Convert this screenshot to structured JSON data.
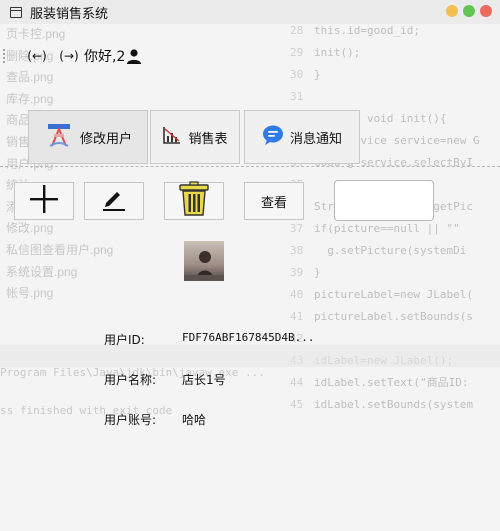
{
  "window": {
    "title": "服装销售系统",
    "controls": {
      "minimize_color": "#f5bf4f",
      "maximize_color": "#61c554",
      "close_color": "#ed6a5e"
    }
  },
  "nav": {
    "back_label": "(←)",
    "forward_label": "(→)",
    "greeting": "你好,2"
  },
  "tabs": [
    {
      "label": "修改用户",
      "icon": "user-edit-icon"
    },
    {
      "label": "销售表",
      "icon": "bar-chart-icon"
    },
    {
      "label": "消息通知",
      "icon": "chat-bubble-icon"
    }
  ],
  "toolbar": {
    "add_icon": "plus-icon",
    "edit_icon": "pen-icon",
    "delete_icon": "trash-icon",
    "view_label": "查看",
    "search_value": ""
  },
  "user": {
    "id_label": "用户ID:",
    "id_value": "FDF76ABF167845D4B...",
    "name_label": "用户名称:",
    "name_value": "店长1号",
    "account_label": "用户账号:",
    "account_value": "哈哈"
  },
  "background": {
    "files": [
      "页卡控.png",
      "删除.png",
      "查品.png",
      "库存.png",
      "商品部管理.png",
      "销售.png",
      "用户.png",
      "统计.png",
      "添加.png",
      "修改.png",
      "私信图查看用户.png",
      "系统设置.png",
      "帐号.png"
    ],
    "code_lines": [
      {
        "n": "28",
        "t": "this.id=good_id;"
      },
      {
        "n": "29",
        "t": "init();"
      },
      {
        "n": "30",
        "t": "}"
      },
      {
        "n": "31",
        "t": ""
      },
      {
        "n": "32",
        "t": "private void init(){"
      },
      {
        "n": "33",
        "t": "GoodService service=new G"
      },
      {
        "n": "34",
        "t": "Good g=service.selectByI"
      },
      {
        "n": "35",
        "t": ""
      },
      {
        "n": "36",
        "t": "String picture= g.getPic"
      },
      {
        "n": "37",
        "t": "if(picture==null || \"\""
      },
      {
        "n": "38",
        "t": "  g.setPicture(systemDi"
      },
      {
        "n": "39",
        "t": "}"
      },
      {
        "n": "40",
        "t": "pictureLabel=new JLabel("
      },
      {
        "n": "41",
        "t": "pictureLabel.setBounds(s"
      },
      {
        "n": "42",
        "t": ""
      },
      {
        "n": "43",
        "t": "idLabel=new JLabel();"
      },
      {
        "n": "44",
        "t": "idLabel.setText(\"商品ID:"
      },
      {
        "n": "45",
        "t": "idLabel.setBounds(system"
      }
    ],
    "status_line": "Program Files\\Java\\jdk\\bin\\javaw.exe ...",
    "status_line2": "ss finished with exit code"
  }
}
